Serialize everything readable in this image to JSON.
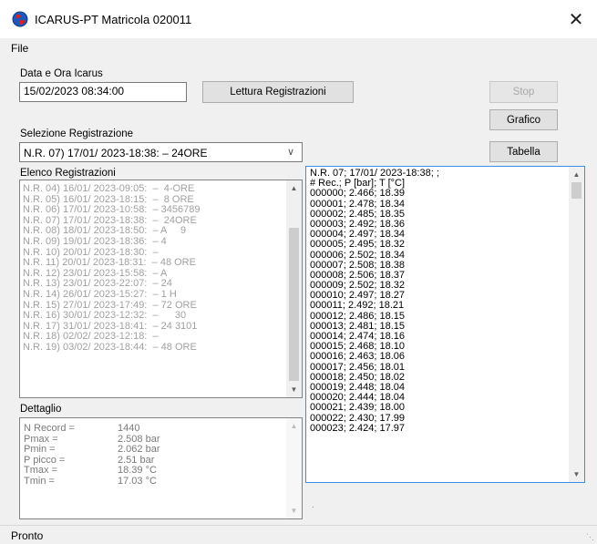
{
  "window": {
    "title": "ICARUS-PT Matricola 020011",
    "close_glyph": "✕"
  },
  "menu": {
    "file": "File"
  },
  "datetime": {
    "label": "Data e Ora Icarus",
    "value": "15/02/2023 08:34:00"
  },
  "buttons": {
    "lettura": "Lettura Registrazioni",
    "stop": "Stop",
    "grafico": "Grafico",
    "tabella": "Tabella"
  },
  "selezione": {
    "label": "Selezione Registrazione",
    "value": "N.R. 07) 17/01/ 2023-18:38:  –  24ORE"
  },
  "elenco": {
    "label": "Elenco Registrazioni",
    "items": [
      "N.R. 04) 16/01/ 2023-09:05:  –  4-ORE",
      "N.R. 05) 16/01/ 2023-18:15:  –  8 ORE",
      "N.R. 06) 17/01/ 2023-10:58:  – 3456789",
      "N.R. 07) 17/01/ 2023-18:38:  –  24ORE",
      "N.R. 08) 18/01/ 2023-18:50:  – A     9",
      "N.R. 09) 19/01/ 2023-18:36:  – 4",
      "N.R. 10) 20/01/ 2023-18:30:  –",
      "N.R. 11) 20/01/ 2023-18:31:  – 48 ORE",
      "N.R. 12) 23/01/ 2023-15:58:  – A",
      "N.R. 13) 23/01/ 2023-22:07:  – 24",
      "N.R. 14) 26/01/ 2023-15:27:  – 1 H",
      "N.R. 15) 27/01/ 2023-17:49:  – 72 ORE",
      "N.R. 16) 30/01/ 2023-12:32:  –      30",
      "N.R. 17) 31/01/ 2023-18:41:  – 24 3101",
      "N.R. 18) 02/02/ 2023-12:18:  –",
      "N.R. 19) 03/02/ 2023-18:44:  – 48 ORE"
    ]
  },
  "dettaglio": {
    "label": "Dettaglio",
    "rows": [
      {
        "key": "N Record =",
        "value": "1440"
      },
      {
        "key": "Pmax =",
        "value": "2.508 bar"
      },
      {
        "key": "Pmin =",
        "value": "2.062 bar"
      },
      {
        "key": "P picco =",
        "value": "2.51 bar"
      },
      {
        "key": "Tmax =",
        "value": "18.39 °C"
      },
      {
        "key": "Tmin =",
        "value": "17.03 °C"
      }
    ]
  },
  "registrazione": {
    "lines": [
      "N.R. 07; 17/01/ 2023-18:38; ;",
      "# Rec.; P [bar]; T [°C]",
      "000000; 2.466; 18.39",
      "000001; 2.478; 18.34",
      "000002; 2.485; 18.35",
      "000003; 2.492; 18.36",
      "000004; 2.497; 18.34",
      "000005; 2.495; 18.32",
      "000006; 2.502; 18.34",
      "000007; 2.508; 18.38",
      "000008; 2.506; 18.37",
      "000009; 2.502; 18.32",
      "000010; 2.497; 18.27",
      "000011; 2.492; 18.21",
      "000012; 2.486; 18.15",
      "000013; 2.481; 18.15",
      "000014; 2.474; 18.16",
      "000015; 2.468; 18.10",
      "000016; 2.463; 18.06",
      "000017; 2.456; 18.01",
      "000018; 2.450; 18.02",
      "000019; 2.448; 18.04",
      "000020; 2.444; 18.04",
      "000021; 2.439; 18.00",
      "000022; 2.430; 17.99",
      "000023; 2.424; 17.97"
    ]
  },
  "status": {
    "text": "Pronto"
  },
  "icons": {
    "app": "globe-icon",
    "close": "close-icon",
    "up": "chevron-up-icon",
    "down": "chevron-down-icon",
    "grip": "resize-grip-icon"
  }
}
